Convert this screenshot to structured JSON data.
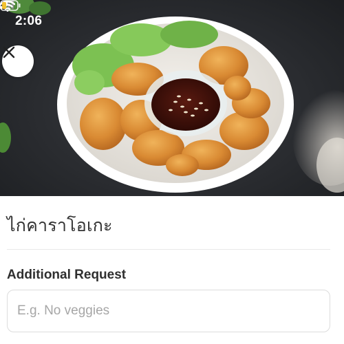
{
  "status_bar": {
    "time": "2:06",
    "icons": [
      "location-arrow-icon",
      "cellular-signal-icon",
      "wifi-icon",
      "battery-low-icon"
    ],
    "battery_color": "#f2c12e"
  },
  "hero": {
    "image": "fried-chicken-bowl-with-dipping-sauce-photo",
    "close_icon": "close-icon"
  },
  "item": {
    "title": "ไก่คาราโอเกะ"
  },
  "additional_request": {
    "label": "Additional Request",
    "placeholder": "E.g. No veggies",
    "value": ""
  },
  "colors": {
    "title_text": "#333333",
    "placeholder_text": "#a6a6a6",
    "input_border": "#dcdcdc"
  }
}
